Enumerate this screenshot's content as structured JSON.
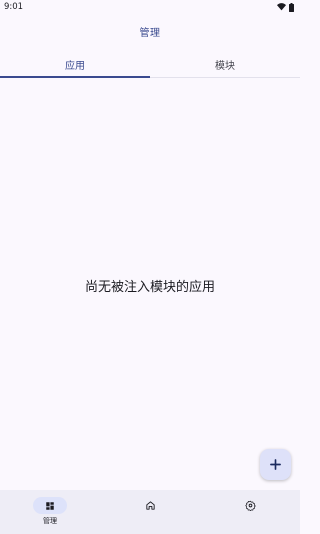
{
  "status_bar": {
    "time": "9:01"
  },
  "app_bar": {
    "title": "管理"
  },
  "tabs": [
    {
      "label": "应用",
      "active": true
    },
    {
      "label": "模块",
      "active": false
    }
  ],
  "empty_state": {
    "message": "尚无被注入模块的应用"
  },
  "fab": {
    "icon": "add-icon"
  },
  "bottom_nav": {
    "items": [
      {
        "label": "管理",
        "icon": "dashboard-icon",
        "active": true
      },
      {
        "label": "",
        "icon": "home-icon",
        "active": false
      },
      {
        "label": "",
        "icon": "settings-icon",
        "active": false
      }
    ]
  },
  "colors": {
    "accent": "#3a4a8f",
    "background": "#fbf8fe",
    "nav_background": "#eeedf6",
    "fab_background": "#dee1f9"
  }
}
